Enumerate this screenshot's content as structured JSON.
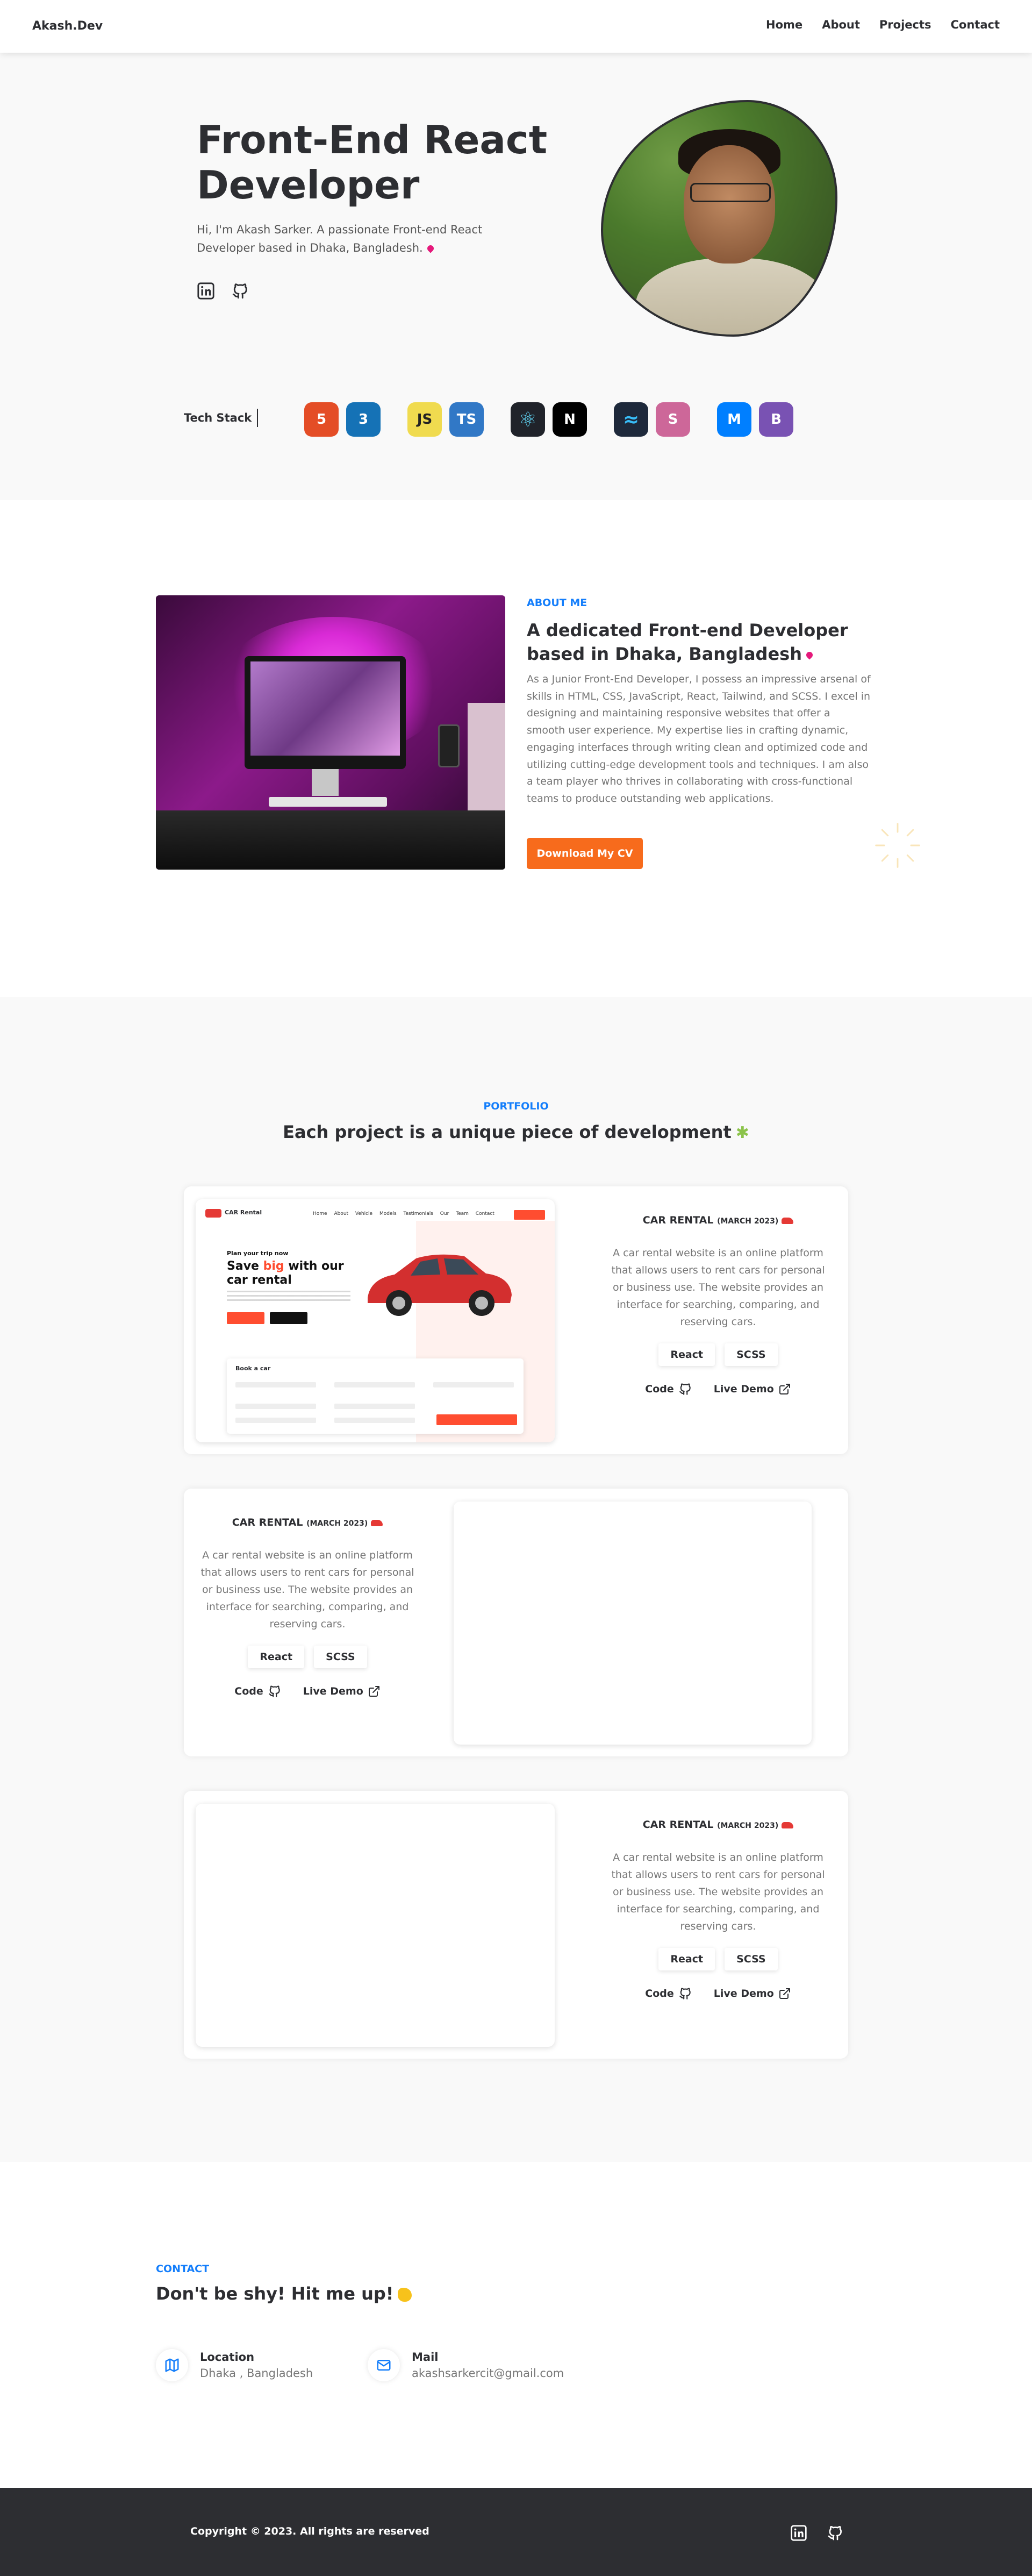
{
  "nav": {
    "brand": "Akash.Dev",
    "links": [
      "Home",
      "About",
      "Projects",
      "Contact"
    ]
  },
  "hero": {
    "title_line1": "Front-End React",
    "title_line2": "Developer",
    "intro": "Hi, I'm Akash Sarker. A passionate Front-end React Developer based in Dhaka, Bangladesh.",
    "social_icons": [
      "linkedin-icon",
      "github-icon"
    ],
    "tech_stack_label": "Tech Stack",
    "tech_stack": [
      {
        "icon": "html5-icon",
        "glyph": "5",
        "color": "#e44d26"
      },
      {
        "icon": "css3-icon",
        "glyph": "3",
        "color": "#1572b6"
      },
      {
        "icon": "javascript-icon",
        "glyph": "JS",
        "color": "#f0db4f"
      },
      {
        "icon": "typescript-icon",
        "glyph": "TS",
        "color": "#3178c6"
      },
      {
        "icon": "react-icon",
        "glyph": "⚛",
        "color": "#20232a"
      },
      {
        "icon": "nextjs-icon",
        "glyph": "N",
        "color": "#000000"
      },
      {
        "icon": "tailwind-icon",
        "glyph": "≈",
        "color": "#1e293b"
      },
      {
        "icon": "sass-icon",
        "glyph": "S",
        "color": "#cd6799"
      },
      {
        "icon": "mui-icon",
        "glyph": "M",
        "color": "#007fff"
      },
      {
        "icon": "bootstrap-icon",
        "glyph": "B",
        "color": "#7952b3"
      }
    ]
  },
  "about": {
    "eyebrow": "ABOUT ME",
    "title": "A dedicated Front-end Developer based in Dhaka, Bangladesh",
    "text": "As a Junior Front-End Developer, I possess an impressive arsenal of skills in HTML, CSS, JavaScript, React, Tailwind, and SCSS. I excel in designing and maintaining responsive websites that offer a smooth user experience. My expertise lies in crafting dynamic, engaging interfaces through writing clean and optimized code and utilizing cutting-edge development tools and techniques. I am also a team player who thrives in collaborating with cross-functional teams to produce outstanding web applications.",
    "cv_button": "Download My CV"
  },
  "portfolio": {
    "eyebrow": "PORTFOLIO",
    "title": "Each project is a unique piece of development",
    "projects": [
      {
        "title": "CAR RENTAL",
        "date": "(MARCH 2023)",
        "description": "A car rental website is an online platform that allows users to rent cars for personal or business use. The website provides an interface for searching, comparing, and reserving cars.",
        "stack": [
          "React",
          "SCSS"
        ],
        "code_label": "Code",
        "demo_label": "Live Demo",
        "mockup": {
          "brand": "CAR Rental",
          "menu": "Home About Vehicle Models Testimonials Our Team Contact",
          "small": "Plan your trip now",
          "headline_pre": "Save ",
          "headline_accent": "big",
          "headline_post": " with our car rental",
          "booking_title": "Book a car"
        }
      },
      {
        "title": "CAR RENTAL",
        "date": "(MARCH 2023)",
        "description": "A car rental website is an online platform that allows users to rent cars for personal or business use. The website provides an interface for searching, comparing, and reserving cars.",
        "stack": [
          "React",
          "SCSS"
        ],
        "code_label": "Code",
        "demo_label": "Live Demo"
      },
      {
        "title": "CAR RENTAL",
        "date": "(MARCH 2023)",
        "description": "A car rental website is an online platform that allows users to rent cars for personal or business use. The website provides an interface for searching, comparing, and reserving cars.",
        "stack": [
          "React",
          "SCSS"
        ],
        "code_label": "Code",
        "demo_label": "Live Demo"
      }
    ]
  },
  "contact": {
    "eyebrow": "CONTACT",
    "title": "Don't be shy! Hit me up!",
    "location_label": "Location",
    "location_value": "Dhaka , Bangladesh",
    "mail_label": "Mail",
    "mail_value": "akashsarkercit@gmail.com"
  },
  "footer": {
    "copyright": "Copyright © 2023. All rights are reserved",
    "social_icons": [
      "linkedin-icon",
      "github-icon"
    ]
  },
  "colors": {
    "accent_blue": "#147efb",
    "cta_orange": "#f76b1c",
    "text_dark": "#2d2e32",
    "footer_bg": "#2d2e32"
  }
}
